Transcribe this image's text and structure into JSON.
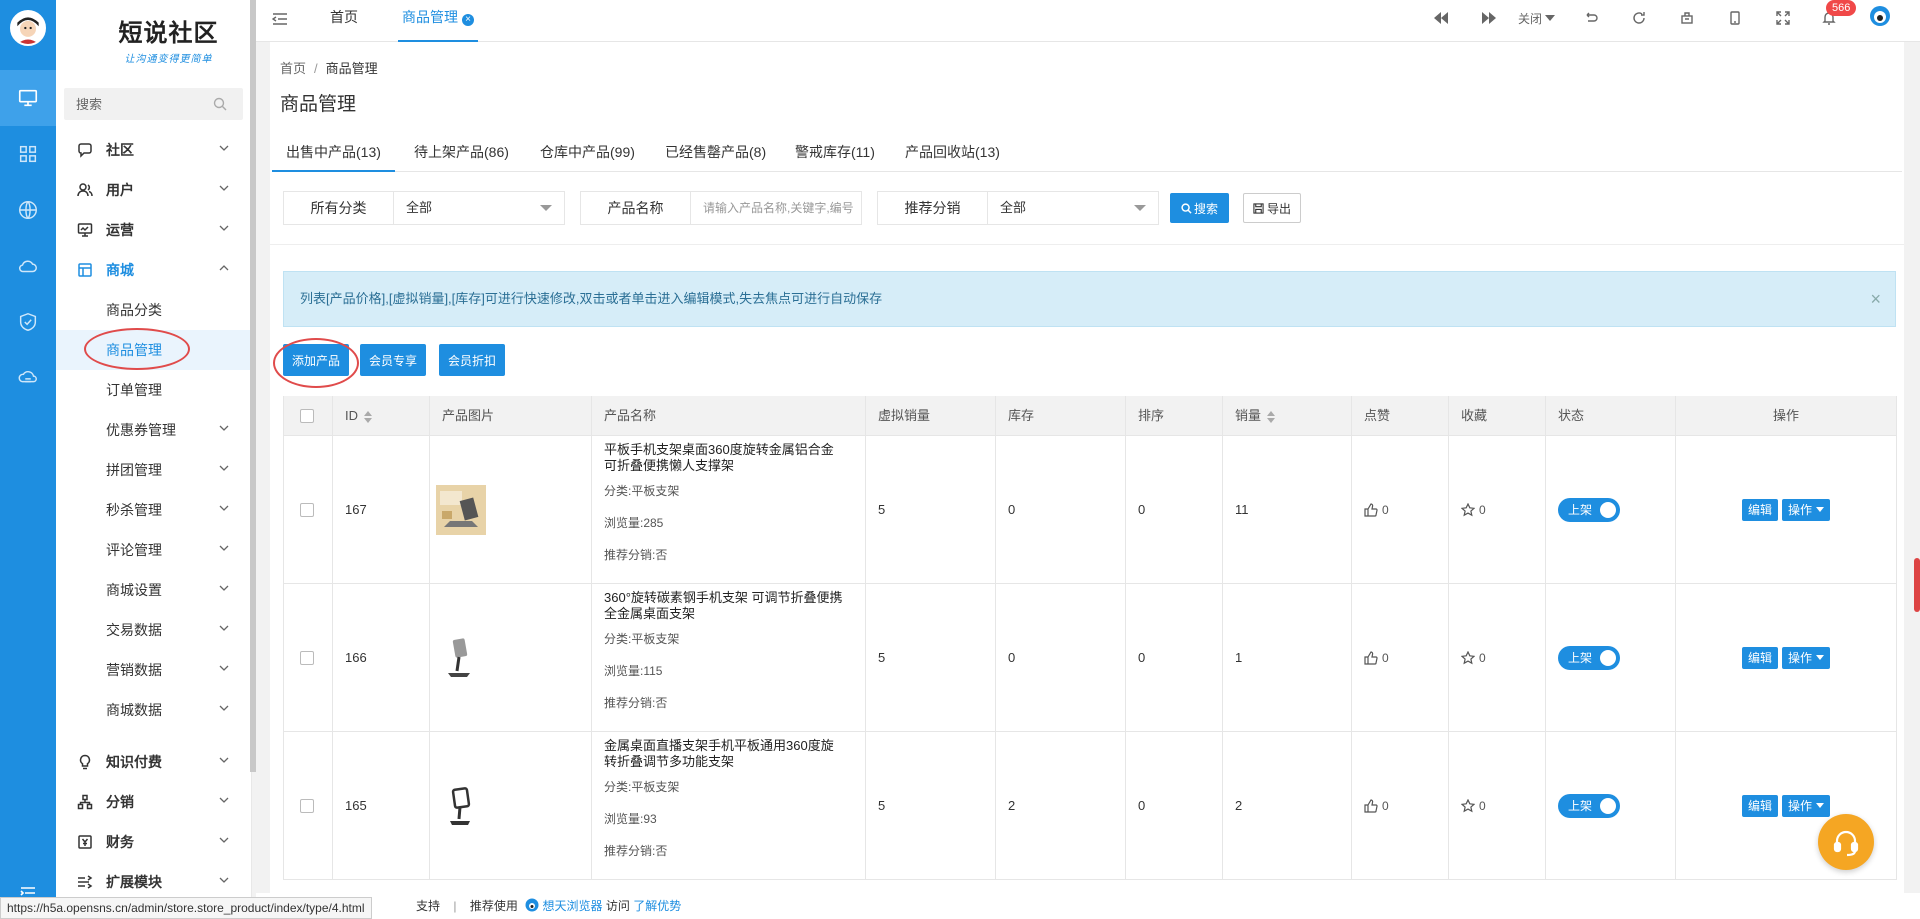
{
  "colors": {
    "accent": "#1e8ee0",
    "badge": "#f04848",
    "alert_bg": "#d6edf8"
  },
  "logo": {
    "title": "短说社区",
    "subtitle": "让沟通变得更简单"
  },
  "sidebar": {
    "search_placeholder": "搜索",
    "menu": [
      {
        "label": "社区",
        "icon": "chat-icon"
      },
      {
        "label": "用户",
        "icon": "users-icon"
      },
      {
        "label": "运营",
        "icon": "monitor-icon"
      },
      {
        "label": "商城",
        "icon": "shop-icon"
      }
    ],
    "shop_sub": [
      "商品分类",
      "商品管理",
      "订单管理",
      "优惠券管理",
      "拼团管理",
      "秒杀管理",
      "评论管理",
      "商城设置",
      "交易数据",
      "营销数据",
      "商城数据"
    ],
    "menu_bottom": [
      {
        "label": "知识付费",
        "icon": "bulb-icon"
      },
      {
        "label": "分销",
        "icon": "tree-icon"
      },
      {
        "label": "财务",
        "icon": "finance-icon"
      },
      {
        "label": "扩展模块",
        "icon": "extend-icon"
      }
    ]
  },
  "topbar": {
    "tabs": [
      "首页",
      "商品管理"
    ],
    "close_label": "关闭",
    "notification_count": "566"
  },
  "breadcrumb": {
    "home": "首页",
    "current": "商品管理"
  },
  "page_title": "商品管理",
  "product_tabs": [
    "出售中产品(13)",
    "待上架产品(86)",
    "仓库中产品(99)",
    "已经售罄产品(8)",
    "警戒库存(11)",
    "产品回收站(13)"
  ],
  "filters": {
    "category_label": "所有分类",
    "category_value": "全部",
    "name_label": "产品名称",
    "name_placeholder": "请输入产品名称,关键字,编号",
    "dist_label": "推荐分销",
    "dist_value": "全部",
    "search_btn": "搜索",
    "export_btn": "导出"
  },
  "alert": "列表[产品价格],[虚拟销量],[库存]可进行快速修改,双击或者单击进入编辑模式,失去焦点可进行自动保存",
  "actions": [
    "添加产品",
    "会员专享",
    "会员折扣"
  ],
  "table": {
    "headers": [
      "ID",
      "产品图片",
      "产品名称",
      "虚拟销量",
      "库存",
      "排序",
      "销量",
      "点赞",
      "收藏",
      "状态",
      "操作"
    ],
    "rows": [
      {
        "id": "167",
        "name": "平板手机支架桌面360度旋转金属铝合金可折叠便携懒人支撑架",
        "category": "分类:平板支架",
        "views": "浏览量:285",
        "dist": "推荐分销:否",
        "virtual_sales": "5",
        "stock": "0",
        "sort": "0",
        "sales": "11",
        "likes": "0",
        "favs": "0",
        "status": "上架"
      },
      {
        "id": "166",
        "name": "360°旋转碳素钢手机支架 可调节折叠便携全金属桌面支架",
        "category": "分类:平板支架",
        "views": "浏览量:115",
        "dist": "推荐分销:否",
        "virtual_sales": "5",
        "stock": "0",
        "sort": "0",
        "sales": "1",
        "likes": "0",
        "favs": "0",
        "status": "上架"
      },
      {
        "id": "165",
        "name": "金属桌面直播支架手机平板通用360度旋转折叠调节多功能支架",
        "category": "分类:平板支架",
        "views": "浏览量:93",
        "dist": "推荐分销:否",
        "virtual_sales": "5",
        "stock": "2",
        "sort": "0",
        "sales": "2",
        "likes": "0",
        "favs": "0",
        "status": "上架"
      }
    ],
    "edit_label": "编辑",
    "ops_label": "操作"
  },
  "footer": {
    "support": "支持",
    "recommend": "推荐使用",
    "browser": "想天浏览器",
    "visit": "访问",
    "learn": "了解优势"
  },
  "status_url": "https://h5a.opensns.cn/admin/store.store_product/index/type/4.html"
}
